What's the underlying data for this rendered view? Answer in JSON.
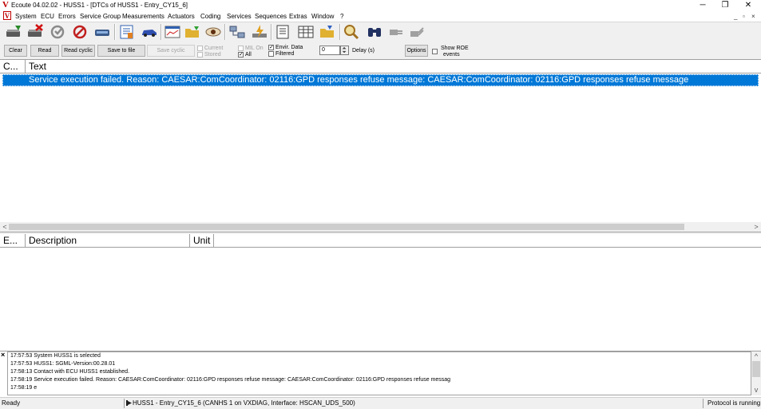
{
  "window": {
    "title": "Ecoute 04.02.02 - HUSS1 - [DTCs of HUSS1 - Entry_CY15_6]",
    "logo": "V",
    "controls": {
      "minimize": "─",
      "restore": "❐",
      "close": "✕"
    },
    "mdi_controls": {
      "minimize": "_",
      "restore": "▫",
      "close": "×"
    }
  },
  "menu": {
    "logo": "V",
    "items": [
      "System",
      "ECU",
      "Errors",
      "Service Group",
      "Measurements",
      "Actuators",
      "Coding",
      "Services",
      "Sequences",
      "Extras",
      "Window",
      "?"
    ]
  },
  "toolbar": {
    "icons": [
      "connect-icon",
      "disconnect-icon",
      "refresh-icon",
      "no-connection-icon",
      "ecu-device-icon",
      "document-list-icon",
      "car-icon",
      "chart-window-icon",
      "open-folder-icon",
      "eye-icon",
      "network-icon",
      "flash-icon",
      "document-icon",
      "table-icon",
      "folder-export-icon",
      "magnifier-icon",
      "binoculars-icon",
      "plug-icon",
      "plug-out-icon"
    ]
  },
  "controls": {
    "clear": "Clear",
    "read": "Read",
    "read_cyclic": "Read cyclic",
    "save_to_file": "Save to file",
    "save_cyclic": "Save cyclic",
    "current": "Current",
    "stored": "Stored",
    "mil_on": "MIL On",
    "all": "All",
    "envir_data": "Envir. Data",
    "filtered": "Filtered",
    "delay_value": "0",
    "delay_label": "Delay (s)",
    "options": "Options",
    "show_roe_line1": "Show ROE",
    "show_roe_line2": "events",
    "checked": {
      "current": false,
      "stored": false,
      "mil_on": false,
      "all": true,
      "envir_data": true,
      "filtered": false,
      "show_roe": false
    }
  },
  "upper_table": {
    "columns": [
      "C...",
      "Text"
    ],
    "rows": [
      {
        "text": "Service execution failed. Reason:  CAESAR:ComCoordinator: 02116:GPD responses refuse message:  CAESAR:ComCoordinator: 02116:GPD responses refuse message"
      }
    ],
    "scroll_left": "<",
    "scroll_right": ">"
  },
  "lower_table": {
    "columns": [
      "E...",
      "Description",
      "Unit"
    ]
  },
  "log": {
    "close": "×",
    "lines": [
      "17:57:53 System HUSS1 is selected",
      "17:57:53 HUSS1: SGML-Version:00.28.01",
      "17:58:13 Contact with ECU HUSS1 established.",
      "17:58:19 Service execution failed. Reason:  CAESAR:ComCoordinator: 02116:GPD responses refuse message:  CAESAR:ComCoordinator: 02116:GPD responses refuse messag",
      "17:58:19 e"
    ],
    "scroll_up": "^",
    "scroll_down": "v"
  },
  "statusbar": {
    "ready": "Ready",
    "connection": "HUSS1 - Entry_CY15_6 (CANHS 1 on VXDIAG, Interface: HSCAN_UDS_500)",
    "protocol": "Protocol is running"
  },
  "colors": {
    "selection": "#0078d7",
    "toolbar_bg": "#f0f0f0",
    "logo_red": "#c00000"
  }
}
